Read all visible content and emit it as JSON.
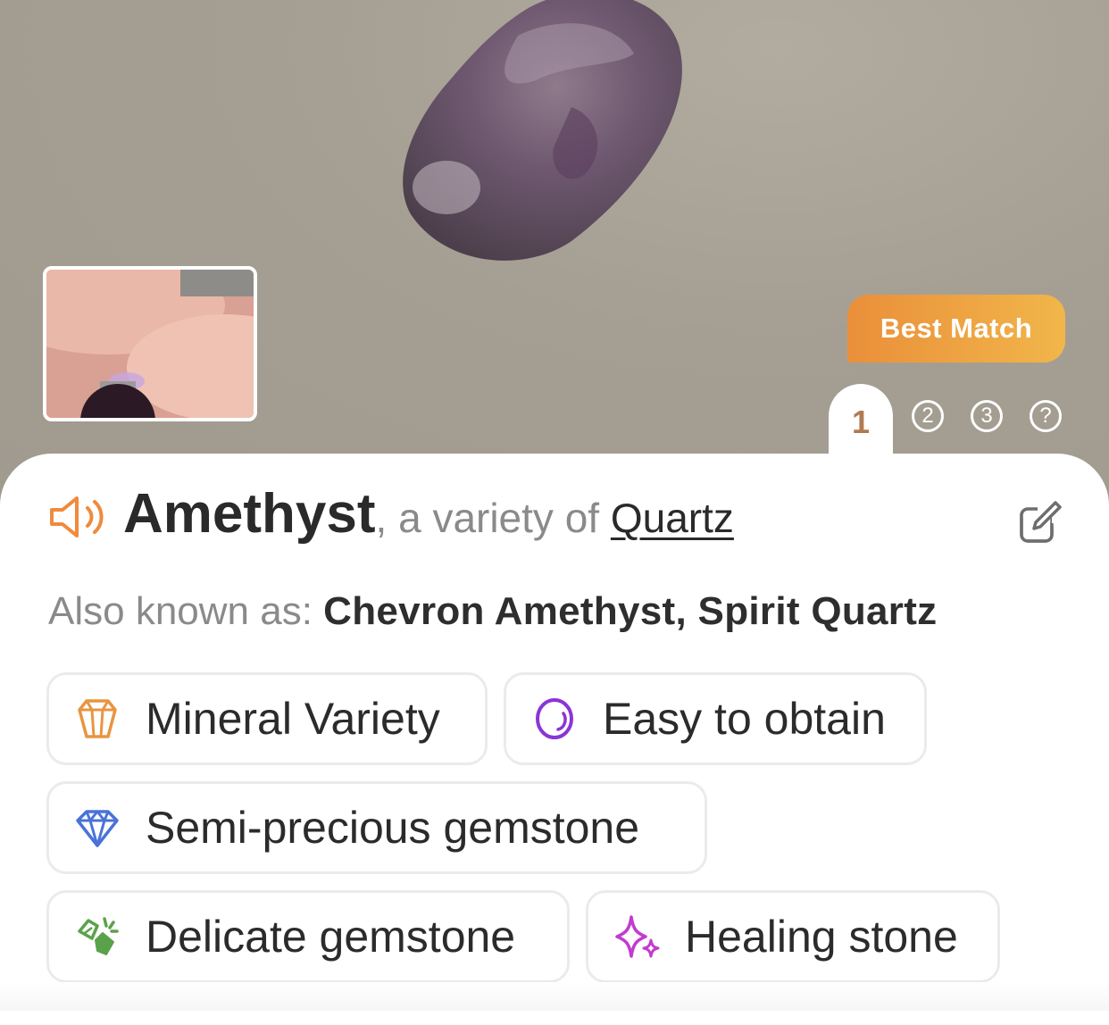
{
  "badge": {
    "label": "Best Match"
  },
  "pagination": {
    "current": "1",
    "pages": [
      "2",
      "3",
      "?"
    ]
  },
  "result": {
    "name": "Amethyst",
    "connector": ", a variety of ",
    "parent": "Quartz"
  },
  "aka": {
    "label": "Also known as: ",
    "names": "Chevron Amethyst, Spirit Quartz"
  },
  "tags": [
    {
      "label": "Mineral Variety",
      "icon": "crystal-icon",
      "color": "#e89541"
    },
    {
      "label": "Easy to obtain",
      "icon": "circle-icon",
      "color": "#8a35d6"
    },
    {
      "label": "Semi-precious gemstone",
      "icon": "diamond-icon",
      "color": "#4a72d8"
    },
    {
      "label": "Delicate gemstone",
      "icon": "broken-crystal-icon",
      "color": "#5aa24a"
    },
    {
      "label": "Healing stone",
      "icon": "sparkle-icon",
      "color": "#c23ad0"
    }
  ],
  "colors": {
    "accent": "#f08a3c",
    "badge_start": "#ea8f3a",
    "badge_end": "#f1b64a"
  }
}
